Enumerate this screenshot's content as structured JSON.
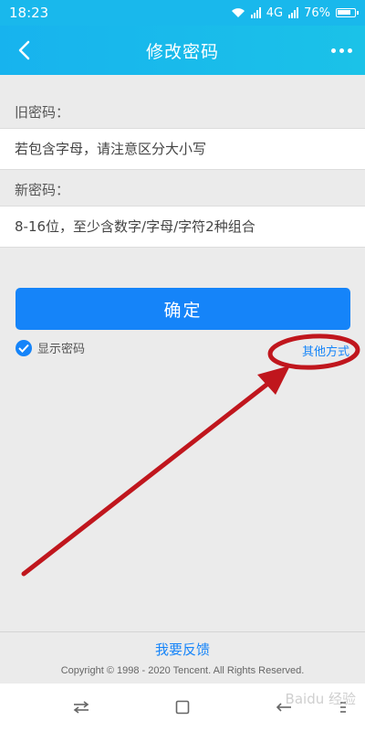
{
  "status": {
    "time": "18:23",
    "network": "4G",
    "battery": "76%"
  },
  "header": {
    "title": "修改密码"
  },
  "old_password": {
    "label": "旧密码：",
    "placeholder": "若包含字母，请注意区分大小写"
  },
  "new_password": {
    "label": "新密码：",
    "placeholder": "8-16位，至少含数字/字母/字符2种组合"
  },
  "confirm_label": "确定",
  "show_password_label": "显示密码",
  "show_password_checked": true,
  "other_methods_label": "其他方式",
  "footer": {
    "feedback": "我要反馈",
    "copyright": "Copyright © 1998 - 2020 Tencent. All Rights Reserved."
  },
  "watermark": "Baidu 经验",
  "colors": {
    "accent": "#1584f9",
    "header": "#17b3ee",
    "annotation": "#c0161d"
  },
  "icons": [
    "wifi-icon",
    "signal-icon",
    "battery-icon",
    "back-arrow-icon",
    "more-icon",
    "check-icon",
    "nav-switch-icon",
    "nav-home-icon",
    "nav-back-icon",
    "nav-menu-icon"
  ]
}
